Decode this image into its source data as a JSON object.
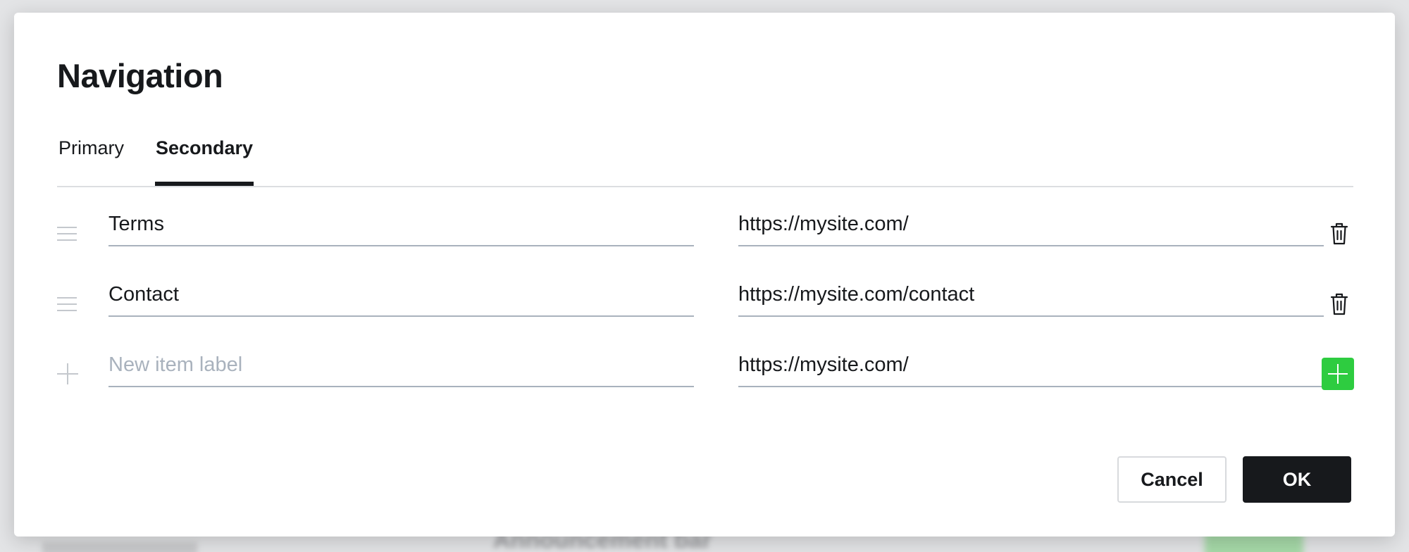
{
  "dialog": {
    "title": "Navigation",
    "tabs": [
      {
        "label": "Primary",
        "active": false
      },
      {
        "label": "Secondary",
        "active": true
      }
    ],
    "items": [
      {
        "label": "Terms",
        "url": "https://mysite.com/"
      },
      {
        "label": "Contact",
        "url": "https://mysite.com/contact"
      }
    ],
    "new_item": {
      "label_value": "",
      "label_placeholder": "New item label",
      "url_value": "https://mysite.com/"
    },
    "cancel_label": "Cancel",
    "ok_label": "OK"
  },
  "icons": {
    "drag": "drag-handle-icon",
    "delete": "trash-icon",
    "add": "plus-icon"
  },
  "colors": {
    "accent_green": "#2ecc40",
    "primary_button": "#17191c",
    "field_underline": "#a9b2bd"
  },
  "backdrop": {
    "text": "Announcement bar"
  }
}
